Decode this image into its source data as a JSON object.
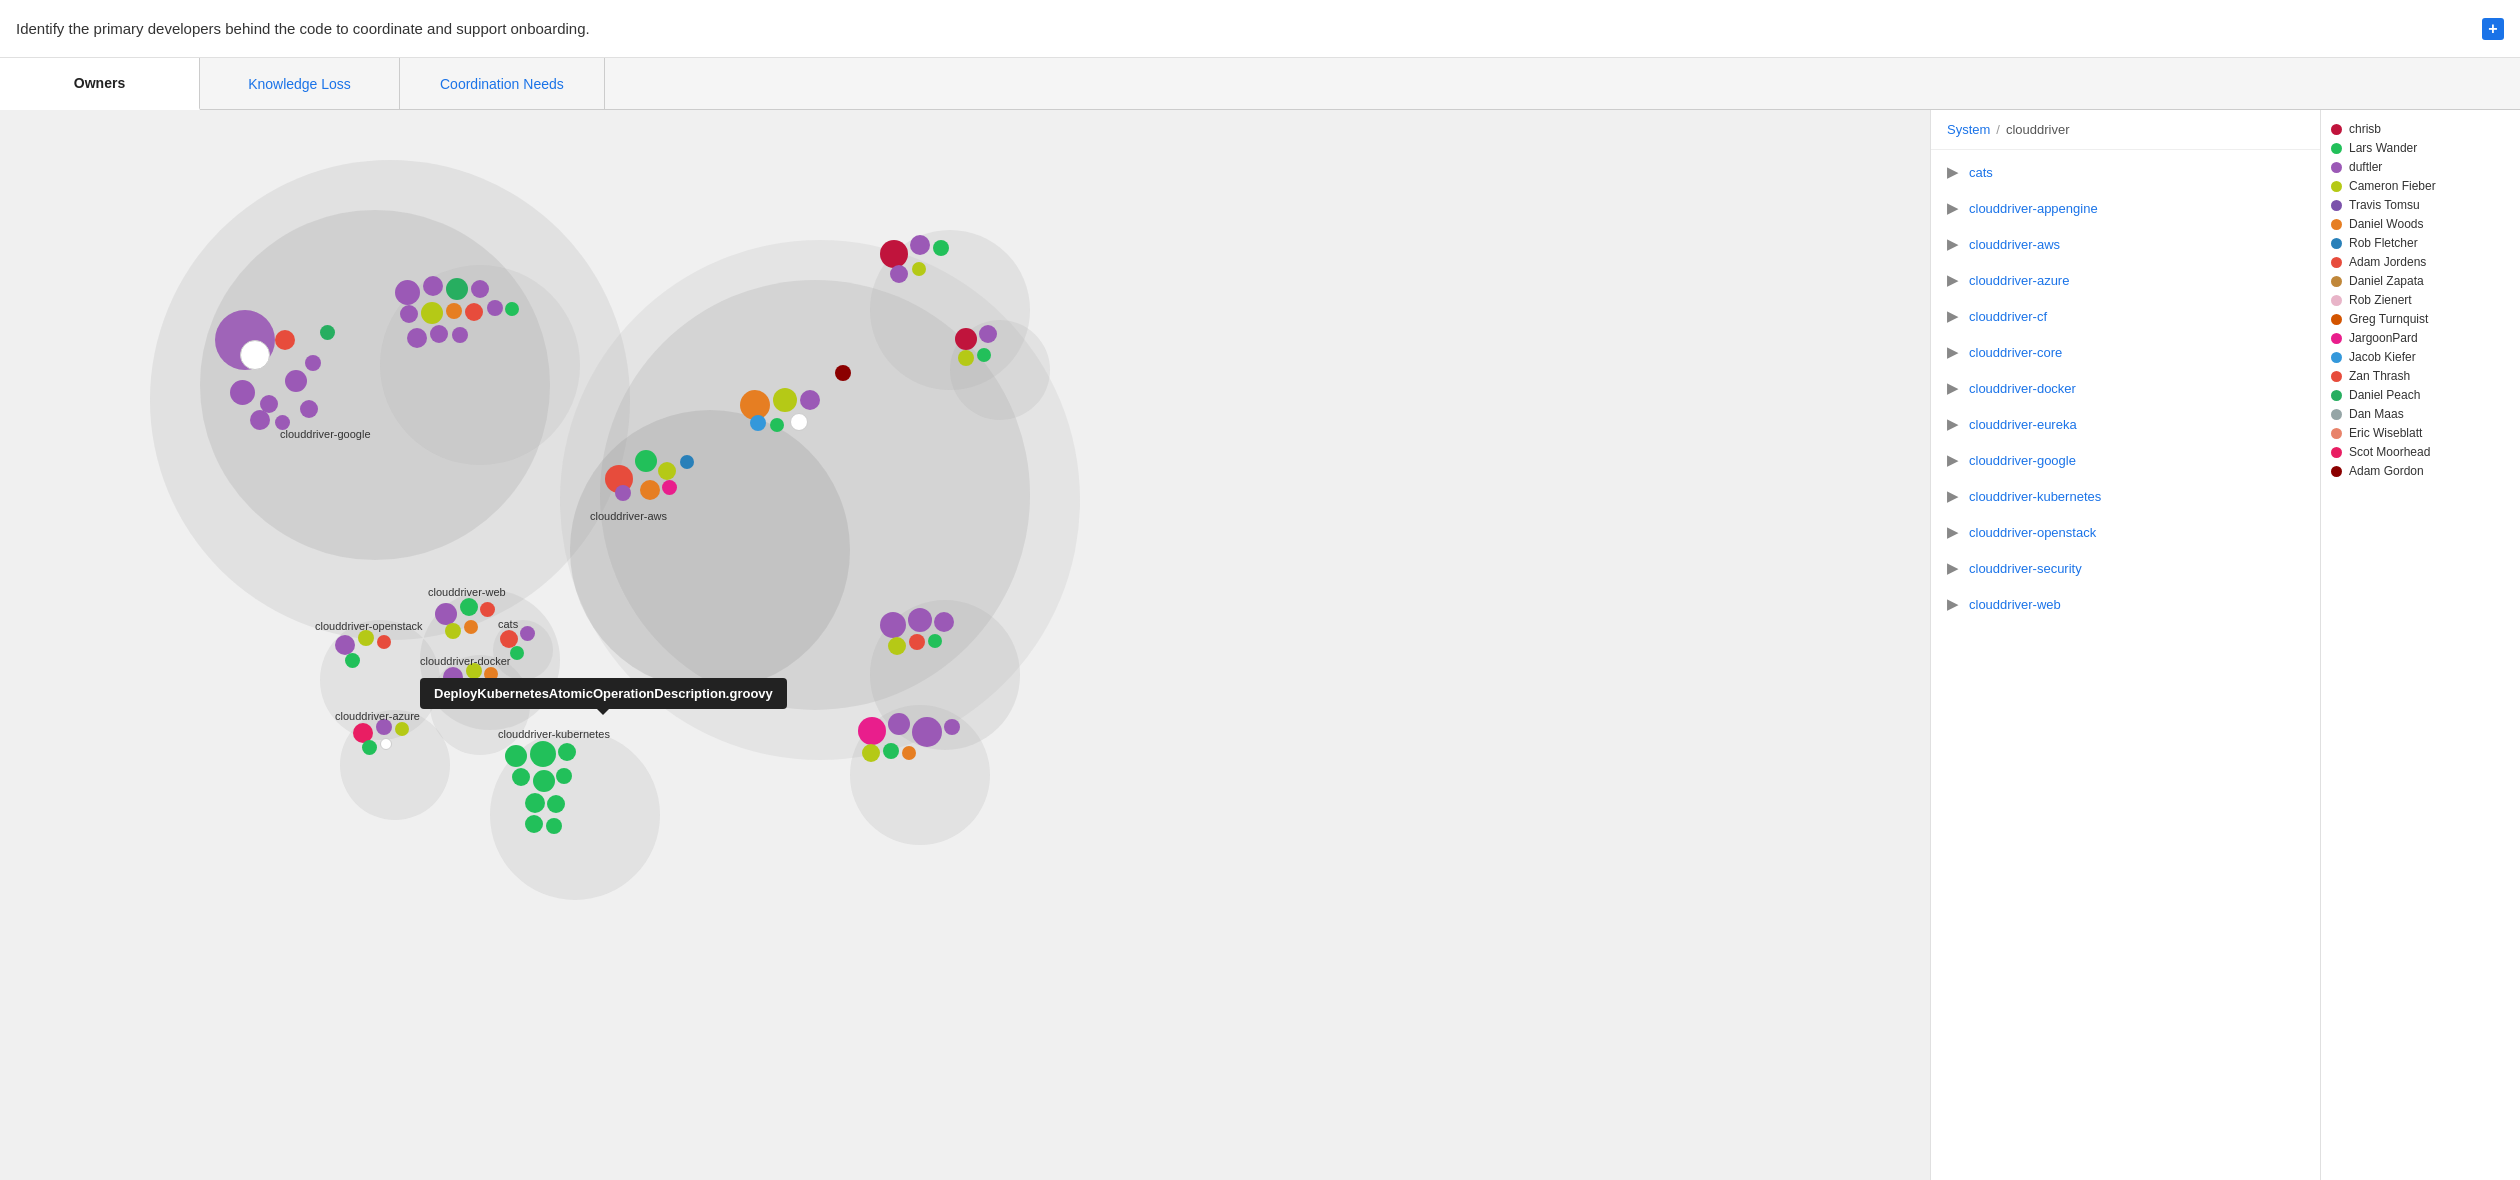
{
  "topbar": {
    "text": "Identify the primary developers behind the code to coordinate and support onboarding.",
    "plus_label": "+"
  },
  "tabs": [
    {
      "id": "owners",
      "label": "Owners",
      "active": true
    },
    {
      "id": "knowledge-loss",
      "label": "Knowledge Loss",
      "active": false
    },
    {
      "id": "coordination-needs",
      "label": "Coordination Needs",
      "active": false
    }
  ],
  "breadcrumb": {
    "system": "System",
    "sep": "/",
    "current": "clouddriver"
  },
  "files": [
    {
      "name": "cats"
    },
    {
      "name": "clouddriver-appengine"
    },
    {
      "name": "clouddriver-aws"
    },
    {
      "name": "clouddriver-azure"
    },
    {
      "name": "clouddriver-cf"
    },
    {
      "name": "clouddriver-core"
    },
    {
      "name": "clouddriver-docker"
    },
    {
      "name": "clouddriver-eureka"
    },
    {
      "name": "clouddriver-google"
    },
    {
      "name": "clouddriver-kubernetes"
    },
    {
      "name": "clouddriver-openstack"
    },
    {
      "name": "clouddriver-security"
    },
    {
      "name": "clouddriver-web"
    }
  ],
  "legend": [
    {
      "name": "chrisb",
      "color": "#c0143c"
    },
    {
      "name": "Lars Wander",
      "color": "#22c05a"
    },
    {
      "name": "duftler",
      "color": "#9b59b6"
    },
    {
      "name": "Cameron Fieber",
      "color": "#b5c916"
    },
    {
      "name": "Travis Tomsu",
      "color": "#7b52ab"
    },
    {
      "name": "Daniel Woods",
      "color": "#e67e22"
    },
    {
      "name": "Rob Fletcher",
      "color": "#2980b9"
    },
    {
      "name": "Adam Jordens",
      "color": "#e74c3c"
    },
    {
      "name": "Daniel Zapata",
      "color": "#c0873a"
    },
    {
      "name": "Rob Zienert",
      "color": "#e8b4c8"
    },
    {
      "name": "Greg Turnquist",
      "color": "#d35400"
    },
    {
      "name": "JargoonPard",
      "color": "#e91e8c"
    },
    {
      "name": "Jacob Kiefer",
      "color": "#3498db"
    },
    {
      "name": "Zan Thrash",
      "color": "#e74c3c"
    },
    {
      "name": "Daniel Peach",
      "color": "#27ae60"
    },
    {
      "name": "Dan Maas",
      "color": "#95a5a6"
    },
    {
      "name": "Eric Wiseblatt",
      "color": "#e8836a"
    },
    {
      "name": "Scot Moorhead",
      "color": "#e91e63"
    },
    {
      "name": "Adam Gordon",
      "color": "#8B0000"
    }
  ],
  "tooltip": {
    "text": "DeployKubernetesAtomicOperationDescription.groovy"
  },
  "bubble_labels": [
    {
      "id": "google",
      "text": "clouddriver-google"
    },
    {
      "id": "aws",
      "text": "clouddriver-aws"
    },
    {
      "id": "web",
      "text": "clouddriver-web"
    },
    {
      "id": "openstack",
      "text": "clouddriver-openstack"
    },
    {
      "id": "cats-label",
      "text": "cats"
    },
    {
      "id": "docker",
      "text": "clouddriver-docker"
    },
    {
      "id": "azure",
      "text": "clouddriver-azure"
    },
    {
      "id": "kubernetes",
      "text": "clouddriver-kubernetes"
    }
  ]
}
